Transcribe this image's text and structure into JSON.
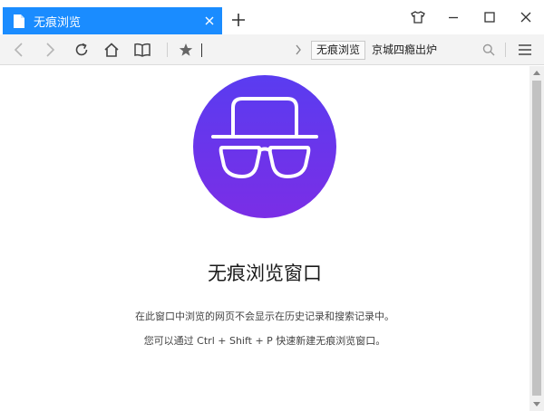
{
  "tab": {
    "title": "无痕浏览"
  },
  "toolbar": {
    "search_engine_chip": "无痕浏览",
    "search_query": "京城四瘾出炉"
  },
  "page": {
    "title": "无痕浏览窗口",
    "line1": "在此窗口中浏览的网页不会显示在历史记录和搜索记录中。",
    "line2": "您可以通过 Ctrl + Shift + P 快速新建无痕浏览窗口。"
  },
  "colors": {
    "tab_bg": "#1a8cff",
    "avatar_top": "#5a3cf0",
    "avatar_bottom": "#7a2ee6"
  }
}
